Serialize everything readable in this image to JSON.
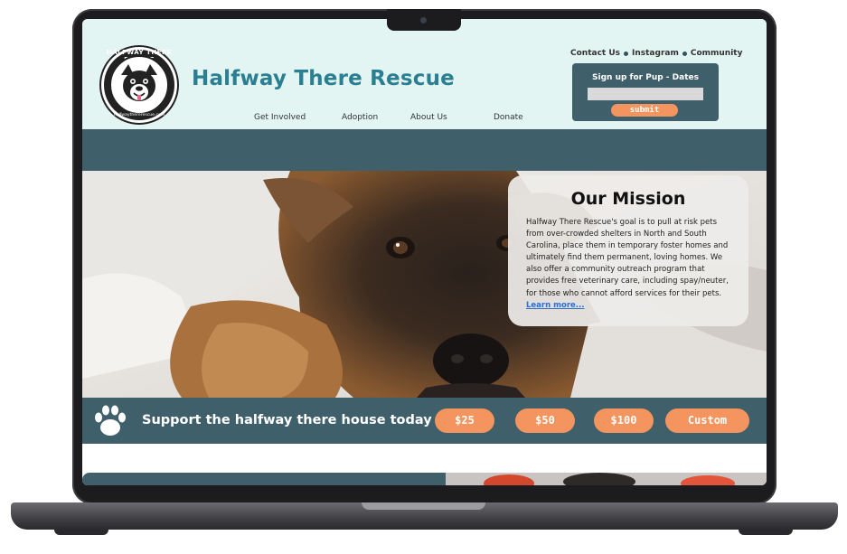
{
  "header": {
    "logo_top_text": "HALFWAY THERE RESCUE",
    "logo_bottom_text": "halfwaythererescue.com",
    "site_title": "Halfway There Rescue",
    "nav": [
      {
        "label": "Get Involved"
      },
      {
        "label": "Adoption"
      },
      {
        "label": "About Us"
      },
      {
        "label": "Donate"
      }
    ],
    "top_links": [
      {
        "label": "Contact Us"
      },
      {
        "label": "Instagram"
      },
      {
        "label": "Community"
      }
    ]
  },
  "signup": {
    "title": "Sign up for Pup - Dates",
    "input_value": "",
    "submit_label": "submit"
  },
  "mission": {
    "title": "Our Mission",
    "text": "Halfway There Rescue's goal is to pull at risk pets from over-crowded shelters in North and South Carolina, place them in temporary foster homes and ultimately find them permanent, loving homes. We also offer a community outreach program that provides free veterinary care, including spay/neuter, for those who cannot afford services for their pets. ",
    "learn_more": "Learn more..."
  },
  "support": {
    "text": "Support the halfway there house today",
    "amounts": [
      {
        "label": "$25"
      },
      {
        "label": "$50"
      },
      {
        "label": "$100"
      },
      {
        "label": "Custom"
      }
    ]
  },
  "icons": {
    "paw": "paw-icon",
    "logo": "dog-logo-icon"
  },
  "colors": {
    "header_bg": "#e3f5f2",
    "title": "#2a7f92",
    "band": "#3f5f6b",
    "accent": "#f4955f",
    "link": "#2b6fd6"
  }
}
